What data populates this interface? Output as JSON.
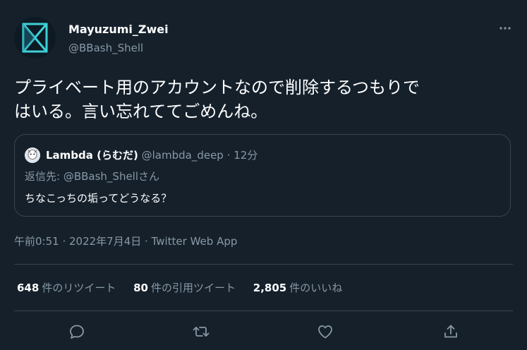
{
  "author": {
    "display_name": "Mayuzumi_Zwei",
    "handle": "@BBash_Shell",
    "avatar_icon": "hexagon-logo-avatar"
  },
  "more_icon": "more-horizontal-icon",
  "tweet": {
    "text_line1": "プライベート用のアカウントなので削除するつもりで",
    "text_line2": "はいる。言い忘れててごめんね。"
  },
  "quote": {
    "avatar_icon": "user-avatar",
    "name": "Lambda (らむだ)",
    "handle": "@lambda_deep",
    "separator": "·",
    "time": "12分",
    "reply_prefix": "返信先: ",
    "reply_handle": "@BBash_Shell",
    "reply_suffix": "さん",
    "text": "ちなこっちの垢ってどうなる？"
  },
  "timestamp": "午前0:51 · 2022年7月4日 · Twitter Web App",
  "stats": {
    "retweets": {
      "count": "648",
      "label": "件のリツイート"
    },
    "quotes": {
      "count": "80",
      "label": "件の引用ツイート"
    },
    "likes": {
      "count": "2,805",
      "label": "件のいいね"
    }
  },
  "actions": [
    "reply-icon",
    "retweet-icon",
    "like-icon",
    "share-icon"
  ],
  "colors": {
    "background": "#15202b",
    "secondary_text": "#8899a6",
    "border": "#38444d"
  }
}
